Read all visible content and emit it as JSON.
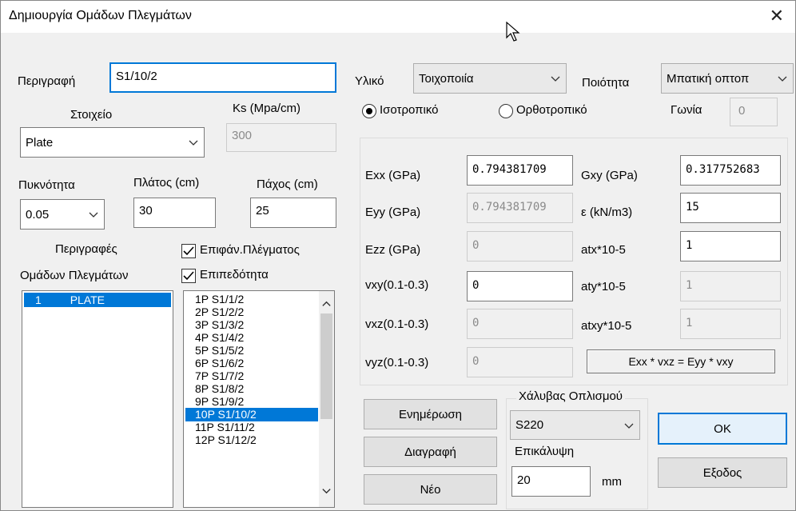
{
  "window": {
    "title": "Δημιουργία Ομάδων Πλεγμάτων",
    "close_glyph": "✕"
  },
  "left": {
    "description_label": "Περιγραφή",
    "description_value": "S1/10/2",
    "element_label": "Στοιχείο",
    "element_value": "Plate",
    "ks_label": "Ks (Mpa/cm)",
    "ks_value": "300",
    "density_label": "Πυκνότητα",
    "density_value": "0.05",
    "width_label": "Πλάτος (cm)",
    "width_value": "30",
    "thickness_label": "Πάχος (cm)",
    "thickness_value": "25",
    "groups_label_1": "Περιγραφές",
    "groups_label_2": "Ομάδων Πλεγμάτων",
    "surface_check_label": "Επιφάν.Πλέγματος",
    "planar_check_label": "Επιπεδότητα",
    "groups": [
      {
        "num": "1",
        "name": "PLATE"
      }
    ],
    "meshes": [
      "1P S1/1/2",
      "2P S1/2/2",
      "3P S1/3/2",
      "4P S1/4/2",
      "5P S1/5/2",
      "6P S1/6/2",
      "7P S1/7/2",
      "8P S1/8/2",
      "9P S1/9/2",
      "10P S1/10/2",
      "11P S1/11/2",
      "12P S1/12/2"
    ],
    "selected_mesh_index": 9
  },
  "right": {
    "material_label": "Υλικό",
    "material_value": "Τοιχοποιία",
    "quality_label": "Ποιότητα",
    "quality_value": "Μπατική οπτοπ",
    "isotropic_label": "Ισοτροπικό",
    "orthotropic_label": "Ορθοτροπικό",
    "angle_label": "Γωνία",
    "angle_value": "0",
    "exx_label": "Exx (GPa)",
    "exx_value": "0.794381709",
    "eyy_label": "Eyy (GPa)",
    "eyy_value": "0.794381709",
    "ezz_label": "Ezz (GPa)",
    "ezz_value": "0",
    "vxy_label": "vxy(0.1-0.3)",
    "vxy_value": "0",
    "vxz_label": "vxz(0.1-0.3)",
    "vxz_value": "0",
    "vyz_label": "vyz(0.1-0.3)",
    "vyz_value": "0",
    "gxy_label": "Gxy (GPa)",
    "gxy_value": "0.317752683",
    "e_label": "ε (kN/m3)",
    "e_value": "15",
    "atx_label": "atx*10-5",
    "atx_value": "1",
    "aty_label": "aty*10-5",
    "aty_value": "1",
    "atxy_label": "atxy*10-5",
    "atxy_value": "1",
    "formula": "Exx * vxz = Eyy * vxy"
  },
  "bottom": {
    "update_button": "Ενημέρωση",
    "delete_button": "Διαγραφή",
    "new_button": "Νέο",
    "steel_label": "Χάλυβας Οπλισμού",
    "steel_value": "S220",
    "cover_label": "Επικάλυψη",
    "cover_value": "20",
    "cover_unit": "mm",
    "ok_button": "OK",
    "exit_button": "Εξοδος"
  }
}
